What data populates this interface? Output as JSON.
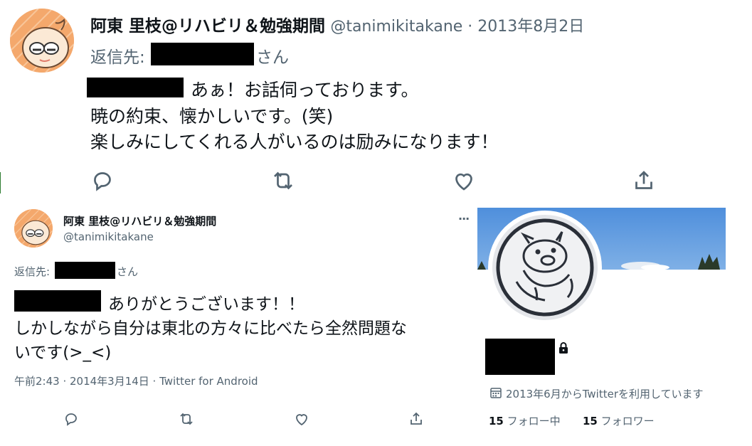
{
  "tweet1": {
    "display_name": "阿東 里枝@リハビリ＆勉強期間",
    "handle_date": "@tanimikitakane · 2013年8月2日",
    "reply_prefix": "返信先:",
    "reply_suffix": "さん",
    "line1": "あぁ！お話伺っております。",
    "line2": "暁の約束、懐かしいです。(笑)",
    "line3": "楽しみにしてくれる人がいるのは励みになります！"
  },
  "tweet2": {
    "display_name": "阿東 里枝@リハビリ＆勉強期間",
    "handle": "@tanimikitakane",
    "more": "···",
    "reply_prefix": "返信先:",
    "reply_suffix": "さん",
    "line1": "ありがとうございます！！",
    "line2": "しかしながら自分は東北の方々に比べたら全然問題な",
    "line3": "いです(>_<)",
    "meta": "午前2:43 · 2014年3月14日 · Twitter for Android"
  },
  "profile": {
    "joined": "2013年6月からTwitterを利用しています",
    "following_count": "15",
    "following_label": "フォロー中",
    "followers_count": "15",
    "followers_label": "フォロワー"
  },
  "icons": {
    "reply": "reply-icon",
    "retweet": "retweet-icon",
    "like": "heart-icon",
    "share": "share-icon",
    "calendar": "calendar-icon",
    "lock": "lock-icon"
  },
  "colors": {
    "text": "#0f1419",
    "muted": "#536471",
    "avatar_bg": "#f3a86a",
    "banner_sky": "#5b95d9"
  }
}
